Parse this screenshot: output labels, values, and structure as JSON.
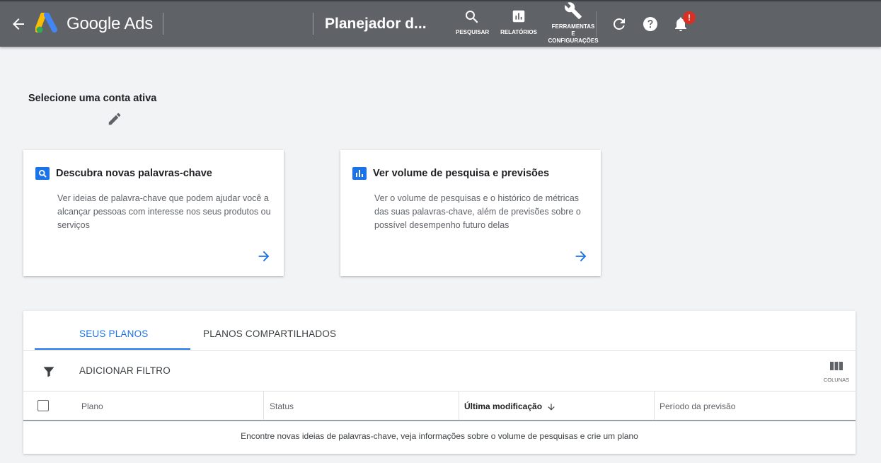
{
  "header": {
    "brand": "Google Ads",
    "page_title": "Planejador d...",
    "tools": [
      {
        "label": "PESQUISAR",
        "icon": "search-icon"
      },
      {
        "label": "RELATÓRIOS",
        "icon": "reports-icon"
      },
      {
        "label_lines": [
          "FERRAMENTAS",
          "E",
          "CONFIGURAÇÕES"
        ],
        "icon": "wrench-icon"
      }
    ],
    "notification_badge": "!",
    "colors": {
      "bar": "#5f6368",
      "badge": "#d93025"
    }
  },
  "account": {
    "label": "Selecione uma conta ativa"
  },
  "cards": [
    {
      "icon": "search-icon",
      "title": "Descubra novas palavras-chave",
      "description": "Ver ideias de palavra-chave que podem ajudar você a alcançar pessoas com interesse nos seus produtos ou serviços"
    },
    {
      "icon": "bar-chart-icon",
      "title": "Ver volume de pesquisa e previsões",
      "description": "Ver o volume de pesquisas e o histórico de métricas das suas palavras-chave, além de previsões sobre o possível desempenho futuro delas"
    }
  ],
  "plans": {
    "tabs": [
      {
        "label": "SEUS PLANOS",
        "active": true
      },
      {
        "label": "PLANOS COMPARTILHADOS",
        "active": false
      }
    ],
    "filter_label": "ADICIONAR FILTRO",
    "columns_label": "COLUNAS",
    "table_headers": [
      "Plano",
      "Status",
      "Última modificação",
      "Período da previsão"
    ],
    "empty_message": "Encontre novas ideias de palavras-chave, veja informações sobre o volume de pesquisas e crie um plano"
  },
  "accent_color": "#1a73e8"
}
